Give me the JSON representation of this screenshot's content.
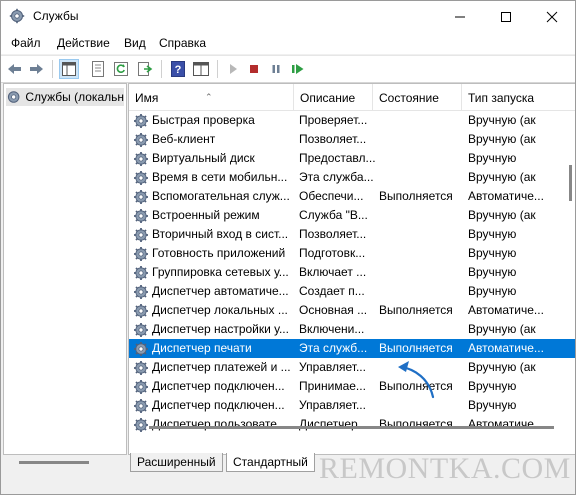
{
  "window": {
    "title": "Службы"
  },
  "menu": [
    "Файл",
    "Действие",
    "Вид",
    "Справка"
  ],
  "toolbar": {
    "icons": [
      "back-arrow-icon",
      "forward-arrow-icon",
      "console-tree-icon",
      "properties-icon",
      "refresh-icon",
      "export-list-icon",
      "help-icon",
      "show-pane-icon",
      "start-service-icon",
      "stop-service-icon",
      "pause-service-icon",
      "restart-service-icon"
    ]
  },
  "tree": {
    "item": "Службы (локальн"
  },
  "list": {
    "columns": [
      "Имя",
      "Описание",
      "Состояние",
      "Тип запуска"
    ],
    "rows": [
      {
        "name": "Быстрая проверка",
        "desc": "Проверяет...",
        "state": "",
        "start": "Вручную (ак"
      },
      {
        "name": "Веб-клиент",
        "desc": "Позволяет...",
        "state": "",
        "start": "Вручную (ак"
      },
      {
        "name": "Виртуальный диск",
        "desc": "Предоставл...",
        "state": "",
        "start": "Вручную"
      },
      {
        "name": "Время в сети мобильн...",
        "desc": "Эта служба...",
        "state": "",
        "start": "Вручную (ак"
      },
      {
        "name": "Вспомогательная служ...",
        "desc": "Обеспечи...",
        "state": "Выполняется",
        "start": "Автоматиче..."
      },
      {
        "name": "Встроенный режим",
        "desc": "Служба \"В...",
        "state": "",
        "start": "Вручную (ак"
      },
      {
        "name": "Вторичный вход в сист...",
        "desc": "Позволяет...",
        "state": "",
        "start": "Вручную"
      },
      {
        "name": "Готовность приложений",
        "desc": "Подготовк...",
        "state": "",
        "start": "Вручную"
      },
      {
        "name": "Группировка сетевых у...",
        "desc": "Включает ...",
        "state": "",
        "start": "Вручную"
      },
      {
        "name": "Диспетчер автоматиче...",
        "desc": "Создает п...",
        "state": "",
        "start": "Вручную"
      },
      {
        "name": "Диспетчер локальных ...",
        "desc": "Основная ...",
        "state": "Выполняется",
        "start": "Автоматиче..."
      },
      {
        "name": "Диспетчер настройки у...",
        "desc": "Включени...",
        "state": "",
        "start": "Вручную (ак"
      },
      {
        "name": "Диспетчер печати",
        "desc": "Эта служб...",
        "state": "Выполняется",
        "start": "Автоматиче..."
      },
      {
        "name": "Диспетчер платежей и ...",
        "desc": "Управляет...",
        "state": "",
        "start": "Вручную (ак"
      },
      {
        "name": "Диспетчер подключен...",
        "desc": "Принимае...",
        "state": "Выполняется",
        "start": "Вручную"
      },
      {
        "name": "Диспетчер подключен...",
        "desc": "Управляет...",
        "state": "",
        "start": "Вручную"
      },
      {
        "name": "Диспетчер пользовате...",
        "desc": "Диспетчер...",
        "state": "Выполняется",
        "start": "Автоматиче..."
      }
    ],
    "selected_index": 12
  },
  "tabs": [
    "Расширенный",
    "Стандартный"
  ],
  "watermark": "REMONTKA.COM",
  "colors": {
    "selection": "#0078d7",
    "arrow": "#1f6fc5",
    "play": "#2e9e44",
    "stop": "#b32d2d"
  }
}
